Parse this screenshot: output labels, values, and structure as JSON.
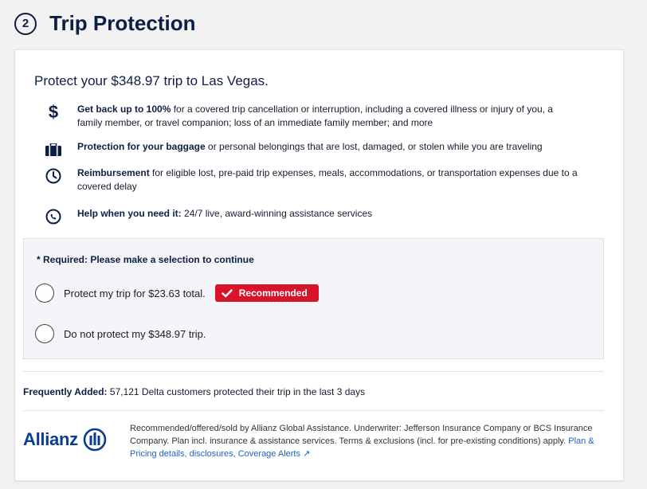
{
  "header": {
    "step_number": "2",
    "title": "Trip Protection"
  },
  "intro": "Protect your $348.97 trip to Las Vegas.",
  "benefits": [
    {
      "icon": "dollar-icon",
      "bold": "Get back up to 100%",
      "text": " for a covered trip cancellation or interruption, including a covered illness or injury of you, a family member, or travel companion; loss of an immediate family member; and more"
    },
    {
      "icon": "suitcase-icon",
      "bold": "Protection for your baggage",
      "text": " or personal belongings that are lost, damaged, or stolen while you are traveling"
    },
    {
      "icon": "clock-icon",
      "bold": "Reimbursement",
      "text": " for eligible lost, pre-paid trip expenses, meals, accommodations, or transportation expenses due to a covered delay"
    },
    {
      "icon": "phone-icon",
      "bold": "Help when you need it:",
      "text": " 24/7 live, award-winning assistance services"
    }
  ],
  "selection": {
    "required_text": "* Required: Please make a selection to continue",
    "option_protect": "Protect my trip for $23.63 total.",
    "recommended_badge": "Recommended",
    "option_decline": "Do not protect my $348.97 trip."
  },
  "frequently": {
    "bold": "Frequently Added:",
    "text": " 57,121 Delta customers protected their trip in the last 3 days"
  },
  "footer": {
    "logo_text": "Allianz",
    "disclaimer": "Recommended/offered/sold by Allianz Global Assistance. Underwriter: Jefferson Insurance Company or BCS Insurance Company. Plan incl. insurance & assistance services. Terms & exclusions (incl. for pre-existing conditions) apply. ",
    "link": "Plan & Pricing details, disclosures, Coverage Alerts ↗"
  },
  "colors": {
    "navy": "#0b1f45",
    "badge_red": "#d8142b",
    "link_blue": "#1f62c6",
    "allianz_blue": "#0a3d8f"
  }
}
